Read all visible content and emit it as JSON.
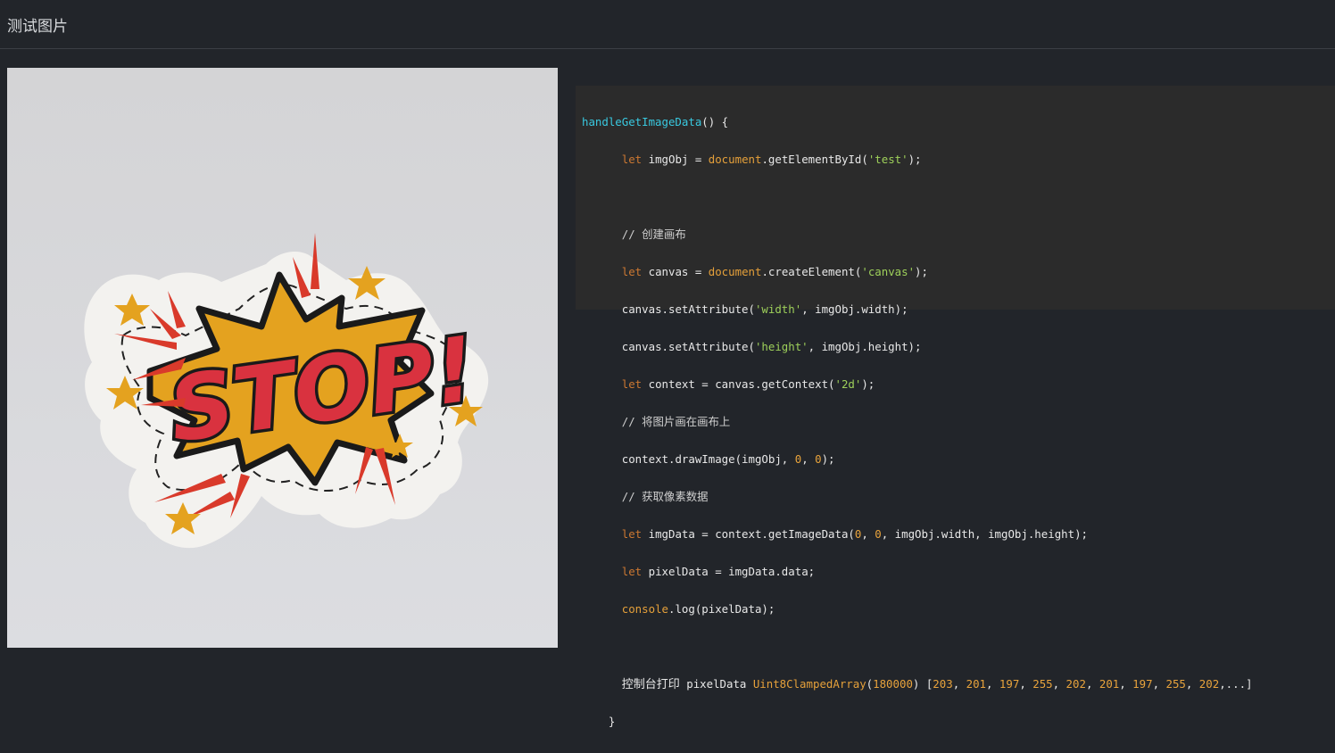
{
  "header": {
    "title": "测试图片"
  },
  "image": {
    "alt": "STOP!",
    "sticker_text": "STOP!",
    "colors": {
      "background": "#d6d7db",
      "sticker_border": "#f4f3f1",
      "burst": "#e4a21f",
      "text_fill": "#d9323f",
      "outline": "#1a1a1a",
      "ray": "#d93a2b",
      "star": "#e4a21f"
    }
  },
  "code": {
    "line1_fn": "handleGetImageData",
    "line1_rest": "() {",
    "line2_kw": "let",
    "line2_a": " imgObj = ",
    "line2_obj": "document",
    "line2_b": ".getElementById(",
    "line2_str": "'test'",
    "line2_c": ");",
    "line3_cmt": "// 创建画布",
    "line4_kw": "let",
    "line4_a": " canvas = ",
    "line4_obj": "document",
    "line4_b": ".createElement(",
    "line4_str": "'canvas'",
    "line4_c": ");",
    "line5_a": "canvas.setAttribute(",
    "line5_str": "'width'",
    "line5_b": ", imgObj.width);",
    "line6_a": "canvas.setAttribute(",
    "line6_str": "'height'",
    "line6_b": ", imgObj.height);",
    "line7_kw": "let",
    "line7_a": " context = canvas.getContext(",
    "line7_str": "'2d'",
    "line7_b": ");",
    "line8_cmt": "// 将图片画在画布上",
    "line9_a": "context.drawImage(imgObj, ",
    "line9_n1": "0",
    "line9_b": ", ",
    "line9_n2": "0",
    "line9_c": ");",
    "line10_cmt": "// 获取像素数据",
    "line11_kw": "let",
    "line11_a": " imgData = context.getImageData(",
    "line11_n1": "0",
    "line11_b": ", ",
    "line11_n2": "0",
    "line11_c": ", imgObj.width, imgObj.height);",
    "line12_kw": "let",
    "line12_a": " pixelData = imgData.data;",
    "line13_obj": "console",
    "line13_a": ".log(pixelData);",
    "line14_cn": "控制台打印",
    "line14_a": " pixelData ",
    "line14_cls": "Uint8ClampedArray",
    "line14_b": "(",
    "line14_n0": "180000",
    "line14_c": ") [",
    "line14_values": [
      "203",
      "201",
      "197",
      "255",
      "202",
      "201",
      "197",
      "255",
      "202"
    ],
    "line14_tail": ",...]",
    "line15": "}"
  }
}
